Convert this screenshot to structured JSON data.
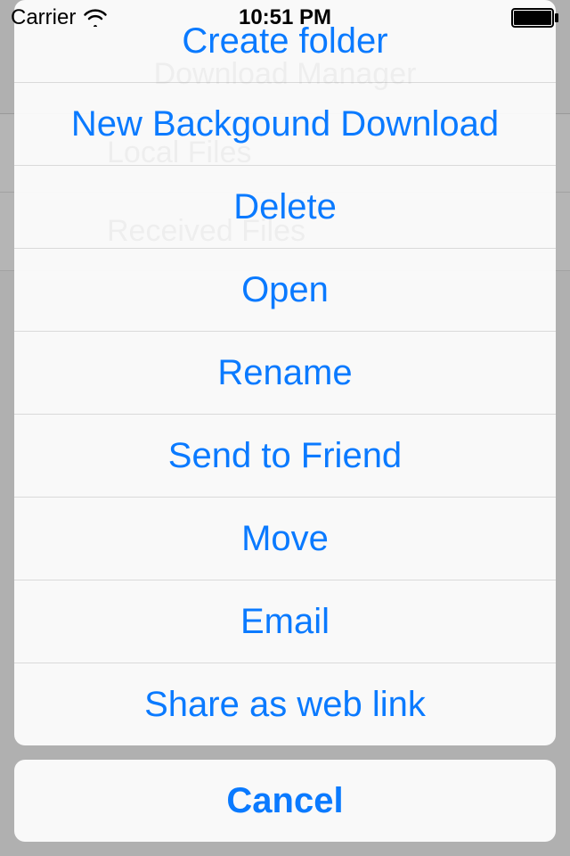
{
  "status_bar": {
    "carrier": "Carrier",
    "time": "10:51 PM"
  },
  "background": {
    "title": "Download Manager",
    "rows": [
      {
        "label": "Local Files"
      },
      {
        "label": "Received Files"
      }
    ]
  },
  "action_sheet": {
    "items": [
      {
        "label": "Create folder"
      },
      {
        "label": "New Backgound Download"
      },
      {
        "label": "Delete"
      },
      {
        "label": "Open"
      },
      {
        "label": "Rename"
      },
      {
        "label": "Send to Friend"
      },
      {
        "label": "Move"
      },
      {
        "label": "Email"
      },
      {
        "label": "Share as web link"
      }
    ],
    "cancel_label": "Cancel"
  }
}
